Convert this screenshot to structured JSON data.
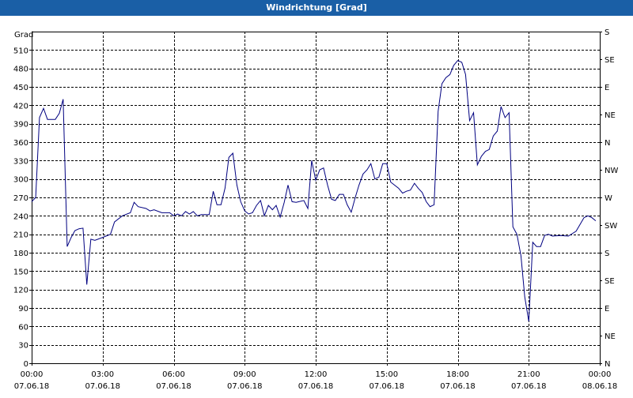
{
  "window": {
    "title": "Windrichtung [Grad]"
  },
  "chart_data": {
    "type": "line",
    "title": "Windrichtung [Grad]",
    "ylabel": "Grad",
    "ylim": [
      0,
      540
    ],
    "yticks": [
      0,
      30,
      60,
      90,
      120,
      150,
      180,
      210,
      240,
      270,
      300,
      330,
      360,
      390,
      420,
      450,
      480,
      510
    ],
    "right_axis_labels": [
      {
        "value": 0,
        "label": "N"
      },
      {
        "value": 45,
        "label": "NE"
      },
      {
        "value": 90,
        "label": "E"
      },
      {
        "value": 135,
        "label": "SE"
      },
      {
        "value": 180,
        "label": "S"
      },
      {
        "value": 225,
        "label": "SW"
      },
      {
        "value": 270,
        "label": "W"
      },
      {
        "value": 315,
        "label": "NW"
      },
      {
        "value": 360,
        "label": "N"
      },
      {
        "value": 405,
        "label": "NE"
      },
      {
        "value": 450,
        "label": "E"
      },
      {
        "value": 495,
        "label": "SE"
      },
      {
        "value": 540,
        "label": "S"
      }
    ],
    "xlim": [
      0,
      24
    ],
    "xticks": [
      {
        "h": 0,
        "time": "00:00",
        "date": "07.06.18"
      },
      {
        "h": 3,
        "time": "03:00",
        "date": "07.06.18"
      },
      {
        "h": 6,
        "time": "06:00",
        "date": "07.06.18"
      },
      {
        "h": 9,
        "time": "09:00",
        "date": "07.06.18"
      },
      {
        "h": 12,
        "time": "12:00",
        "date": "07.06.18"
      },
      {
        "h": 15,
        "time": "15:00",
        "date": "07.06.18"
      },
      {
        "h": 18,
        "time": "18:00",
        "date": "07.06.18"
      },
      {
        "h": 21,
        "time": "21:00",
        "date": "07.06.18"
      },
      {
        "h": 24,
        "time": "00:00",
        "date": "08.06.18"
      }
    ],
    "grid": true,
    "line_color": "#000080",
    "series": [
      {
        "points": [
          [
            0.0,
            263
          ],
          [
            0.17,
            270
          ],
          [
            0.33,
            400
          ],
          [
            0.5,
            415
          ],
          [
            0.67,
            397
          ],
          [
            1.0,
            397
          ],
          [
            1.17,
            407
          ],
          [
            1.33,
            430
          ],
          [
            1.5,
            190
          ],
          [
            1.67,
            205
          ],
          [
            1.83,
            216
          ],
          [
            2.0,
            219
          ],
          [
            2.17,
            220
          ],
          [
            2.33,
            128
          ],
          [
            2.5,
            202
          ],
          [
            2.67,
            200
          ],
          [
            3.0,
            205
          ],
          [
            3.33,
            210
          ],
          [
            3.5,
            230
          ],
          [
            3.83,
            240
          ],
          [
            4.17,
            245
          ],
          [
            4.33,
            262
          ],
          [
            4.5,
            255
          ],
          [
            4.83,
            252
          ],
          [
            5.0,
            248
          ],
          [
            5.17,
            250
          ],
          [
            5.5,
            245
          ],
          [
            5.83,
            245
          ],
          [
            6.0,
            240
          ],
          [
            6.17,
            243
          ],
          [
            6.33,
            240
          ],
          [
            6.5,
            247
          ],
          [
            6.67,
            243
          ],
          [
            6.83,
            247
          ],
          [
            7.0,
            240
          ],
          [
            7.17,
            242
          ],
          [
            7.5,
            242
          ],
          [
            7.67,
            280
          ],
          [
            7.83,
            258
          ],
          [
            8.0,
            258
          ],
          [
            8.17,
            285
          ],
          [
            8.33,
            335
          ],
          [
            8.5,
            342
          ],
          [
            8.67,
            290
          ],
          [
            8.83,
            263
          ],
          [
            9.0,
            248
          ],
          [
            9.17,
            243
          ],
          [
            9.33,
            245
          ],
          [
            9.5,
            257
          ],
          [
            9.67,
            265
          ],
          [
            9.83,
            240
          ],
          [
            10.0,
            257
          ],
          [
            10.17,
            250
          ],
          [
            10.33,
            257
          ],
          [
            10.5,
            238
          ],
          [
            10.67,
            262
          ],
          [
            10.83,
            290
          ],
          [
            11.0,
            263
          ],
          [
            11.17,
            262
          ],
          [
            11.5,
            265
          ],
          [
            11.67,
            252
          ],
          [
            11.83,
            330
          ],
          [
            12.0,
            298
          ],
          [
            12.17,
            315
          ],
          [
            12.33,
            318
          ],
          [
            12.5,
            290
          ],
          [
            12.67,
            267
          ],
          [
            12.83,
            265
          ],
          [
            13.0,
            275
          ],
          [
            13.17,
            275
          ],
          [
            13.33,
            258
          ],
          [
            13.5,
            246
          ],
          [
            13.67,
            270
          ],
          [
            13.83,
            290
          ],
          [
            14.0,
            308
          ],
          [
            14.17,
            315
          ],
          [
            14.33,
            325
          ],
          [
            14.5,
            300
          ],
          [
            14.67,
            303
          ],
          [
            14.83,
            325
          ],
          [
            15.0,
            325
          ],
          [
            15.17,
            295
          ],
          [
            15.33,
            290
          ],
          [
            15.5,
            285
          ],
          [
            15.67,
            277
          ],
          [
            15.83,
            280
          ],
          [
            16.0,
            282
          ],
          [
            16.17,
            293
          ],
          [
            16.33,
            285
          ],
          [
            16.5,
            278
          ],
          [
            16.67,
            263
          ],
          [
            16.83,
            255
          ],
          [
            17.0,
            258
          ],
          [
            17.17,
            410
          ],
          [
            17.33,
            455
          ],
          [
            17.5,
            465
          ],
          [
            17.67,
            470
          ],
          [
            17.83,
            485
          ],
          [
            18.0,
            493
          ],
          [
            18.17,
            490
          ],
          [
            18.33,
            470
          ],
          [
            18.5,
            395
          ],
          [
            18.67,
            408
          ],
          [
            18.83,
            323
          ],
          [
            19.0,
            337
          ],
          [
            19.17,
            345
          ],
          [
            19.33,
            348
          ],
          [
            19.5,
            370
          ],
          [
            19.67,
            378
          ],
          [
            19.83,
            418
          ],
          [
            20.0,
            400
          ],
          [
            20.17,
            408
          ],
          [
            20.33,
            222
          ],
          [
            20.5,
            210
          ],
          [
            20.67,
            175
          ],
          [
            20.83,
            108
          ],
          [
            21.0,
            68
          ],
          [
            21.17,
            197
          ],
          [
            21.33,
            190
          ],
          [
            21.5,
            190
          ],
          [
            21.67,
            208
          ],
          [
            21.83,
            210
          ],
          [
            22.0,
            207
          ],
          [
            22.33,
            208
          ],
          [
            22.67,
            207
          ],
          [
            23.0,
            215
          ],
          [
            23.33,
            237
          ],
          [
            23.5,
            240
          ],
          [
            23.67,
            237
          ],
          [
            23.83,
            232
          ]
        ]
      }
    ]
  }
}
